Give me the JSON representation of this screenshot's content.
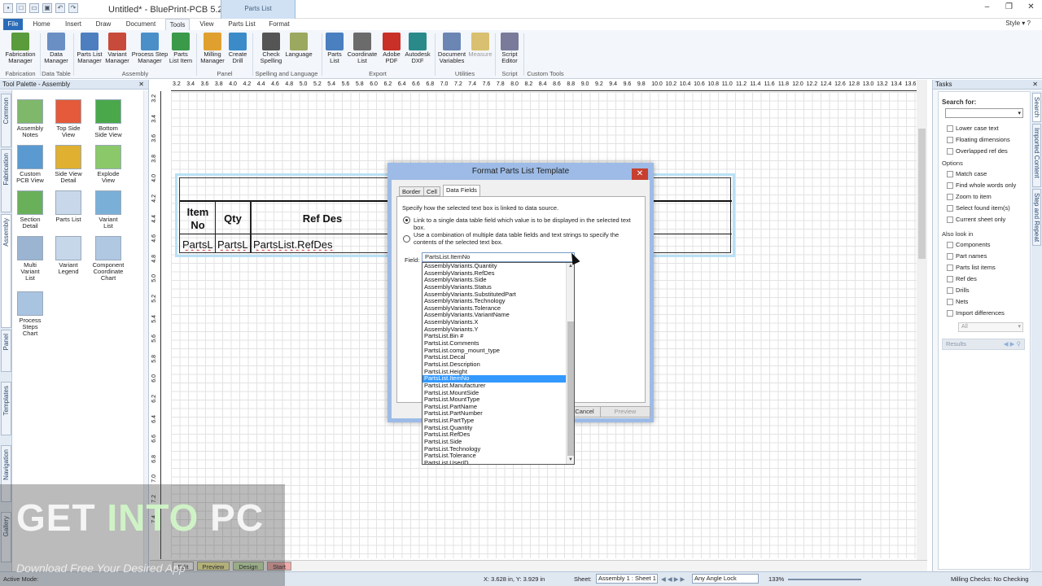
{
  "window": {
    "title": "Untitled* - BluePrint-PCB 5.2",
    "context_tab_group": "Parts List",
    "style_label": "Style"
  },
  "ribbon_tabs": [
    "File",
    "Home",
    "Insert",
    "Draw",
    "Document",
    "Tools",
    "View",
    "Parts List",
    "Format"
  ],
  "active_tab": "Tools",
  "ribbon": {
    "buttons": [
      {
        "label": "Fabrication\nManager",
        "color": "#5a9b3c"
      },
      {
        "label": "Data\nManager",
        "color": "#6a8fc4"
      },
      {
        "label": "Parts List\nManager",
        "color": "#4d7fc0"
      },
      {
        "label": "Variant\nManager",
        "color": "#c84a3a"
      },
      {
        "label": "Process Step\nManager",
        "color": "#4a8fc8"
      },
      {
        "label": "Parts\nList Item",
        "color": "#3a9a4a"
      },
      {
        "label": "Milling\nManager",
        "color": "#e0a030"
      },
      {
        "label": "Create\nDrill",
        "color": "#3b8bc9"
      },
      {
        "label": "Check\nSpelling",
        "color": "#555555"
      },
      {
        "label": "Language",
        "color": "#9aa860"
      },
      {
        "label": "Parts\nList",
        "color": "#4a7fc0"
      },
      {
        "label": "Coordinate\nList",
        "color": "#6b6b6b"
      },
      {
        "label": "Adobe\nPDF",
        "color": "#c83028"
      },
      {
        "label": "Autodesk\nDXF",
        "color": "#2a8a8a"
      },
      {
        "label": "Document\nVariables",
        "color": "#6b86b3"
      },
      {
        "label": "Measure",
        "color": "#d8c070"
      },
      {
        "label": "Script\nEditor",
        "color": "#7a7a9a"
      }
    ],
    "groups": [
      "Fabrication",
      "Data Table",
      "Assembly",
      "Panel",
      "Spelling and Language",
      "Export",
      "Utilities",
      "Script",
      "Custom Tools"
    ]
  },
  "palette": {
    "title": "Tool Palette - Assembly",
    "side_tabs": [
      "Common",
      "Fabrication",
      "Assembly",
      "Panel",
      "Templates",
      "Navigation",
      "Gallery"
    ],
    "tools": [
      {
        "label": "Assembly\nNotes",
        "color": "#7fb86a"
      },
      {
        "label": "Top Side\nView",
        "color": "#e45a3a"
      },
      {
        "label": "Bottom\nSide View",
        "color": "#4aa84a"
      },
      {
        "label": "Custom\nPCB View",
        "color": "#5a9ad0"
      },
      {
        "label": "Side View\nDetail",
        "color": "#e0b030"
      },
      {
        "label": "Explode\nView",
        "color": "#8ac86a"
      },
      {
        "label": "Section\nDetail",
        "color": "#6ab05a"
      },
      {
        "label": "Parts List",
        "color": "#c8d8ea"
      },
      {
        "label": "Variant\nList",
        "color": "#7ab0d8"
      },
      {
        "label": "Multi\nVariant\nList",
        "color": "#9ab4d2"
      },
      {
        "label": "Variant\nLegend",
        "color": "#c6d7ea"
      },
      {
        "label": "Component\nCoordinate\nChart",
        "color": "#b0c8e2"
      },
      {
        "label": "Process\nSteps\nChart",
        "color": "#a8c4e0"
      }
    ]
  },
  "ruler": {
    "h_ticks": [
      "3.2",
      "3.4",
      "3.6",
      "3.8",
      "4.0",
      "4.2",
      "4.4",
      "4.6",
      "4.8",
      "5.0",
      "5.2",
      "5.4",
      "5.6",
      "5.8",
      "6.0",
      "6.2",
      "6.4",
      "6.6",
      "6.8",
      "7.0",
      "7.2",
      "7.4",
      "7.6",
      "7.8",
      "8.0",
      "8.2",
      "8.4",
      "8.6",
      "8.8",
      "9.0",
      "9.2",
      "9.4",
      "9.6",
      "9.8",
      "10.0",
      "10.2",
      "10.4",
      "10.6",
      "10.8",
      "11.0",
      "11.2",
      "11.4",
      "11.6",
      "11.8",
      "12.0",
      "12.2",
      "12.4",
      "12.6",
      "12.8",
      "13.0",
      "13.2",
      "13.4",
      "13.6"
    ],
    "v_ticks": [
      "3.2",
      "3.4",
      "3.6",
      "3.8",
      "4.0",
      "4.2",
      "4.4",
      "4.6",
      "4.8",
      "5.0",
      "5.2",
      "5.4",
      "5.6",
      "5.8",
      "6.0",
      "6.2",
      "6.4",
      "6.6",
      "6.8",
      "7.0",
      "7.2",
      "7.4"
    ]
  },
  "parts_table": {
    "headers": [
      "Item\nNo",
      "Qty",
      "Ref Des"
    ],
    "cells": [
      "PartsL",
      "PartsL",
      "PartsList.RefDes"
    ]
  },
  "dialog": {
    "title": "Format Parts List Template",
    "tabs": [
      "Border",
      "Cell",
      "Data Fields"
    ],
    "active_tab": "Data Fields",
    "description": "Specify how the selected text box is linked to data source.",
    "option_single": "Link to a single data table field which value is to be displayed in the selected text box.",
    "option_multi": "Use a combination of multiple data table fields and text strings to specify the contents of the selected text box.",
    "field_label": "Field:",
    "field_value": "PartsList.ItemNo",
    "cancel_label": "Cancel",
    "preview_label": "Preview"
  },
  "field_options": [
    "AssemblyVariants.Quantity",
    "AssemblyVariants.RefDes",
    "AssemblyVariants.Side",
    "AssemblyVariants.Status",
    "AssemblyVariants.SubstitutedPart",
    "AssemblyVariants.Technology",
    "AssemblyVariants.Tolerance",
    "AssemblyVariants.VariantName",
    "AssemblyVariants.X",
    "AssemblyVariants.Y",
    "PartsList.Bin #",
    "PartsList.Comments",
    "PartsList.comp_mount_type",
    "PartsList.Decal",
    "PartsList.Description",
    "PartsList.Height",
    "PartsList.ItemNo",
    "PartsList.Manufacturer",
    "PartsList.MountSide",
    "PartsList.MountType",
    "PartsList.PartName",
    "PartsList.PartNumber",
    "PartsList.PartType",
    "PartsList.Quantity",
    "PartsList.RefDes",
    "PartsList.Side",
    "PartsList.Technology",
    "PartsList.Tolerance",
    "PartsList.UserID"
  ],
  "selected_option": "PartsList.ItemNo",
  "tasks": {
    "title": "Tasks",
    "search_label": "Search for:",
    "checks_top": [
      "Lower case text",
      "Floating dimensions",
      "Overlapped ref des"
    ],
    "options_label": "Options",
    "checks_options": [
      "Match case",
      "Find whole words only",
      "Zoom to item",
      "Select found item(s)",
      "Current sheet only"
    ],
    "also_look_label": "Also look in",
    "checks_also": [
      "Components",
      "Part names",
      "Parts list items",
      "Ref des",
      "Drills",
      "Nets",
      "Import differences"
    ],
    "scope_value": "All",
    "results_label": "Results",
    "side_tabs": [
      "Search",
      "Imported Content",
      "Step and Repeat"
    ]
  },
  "sheet_tabs": [
    "Edit",
    "Preview",
    "Design",
    "Start"
  ],
  "status": {
    "mode_label": "Active Mode:",
    "coords": "X: 3.628 in, Y: 3.929 in",
    "sheet_label": "Sheet:",
    "sheet_value": "Assembly 1 : Sheet 1",
    "angle_value": "Any Angle Lock",
    "zoom": "133%",
    "milling": "Milling Checks: No Checking"
  },
  "watermark": {
    "big_a": "GET ",
    "big_b": "INTO",
    "big_c": " PC",
    "small": "Download Free Your Desired App"
  }
}
